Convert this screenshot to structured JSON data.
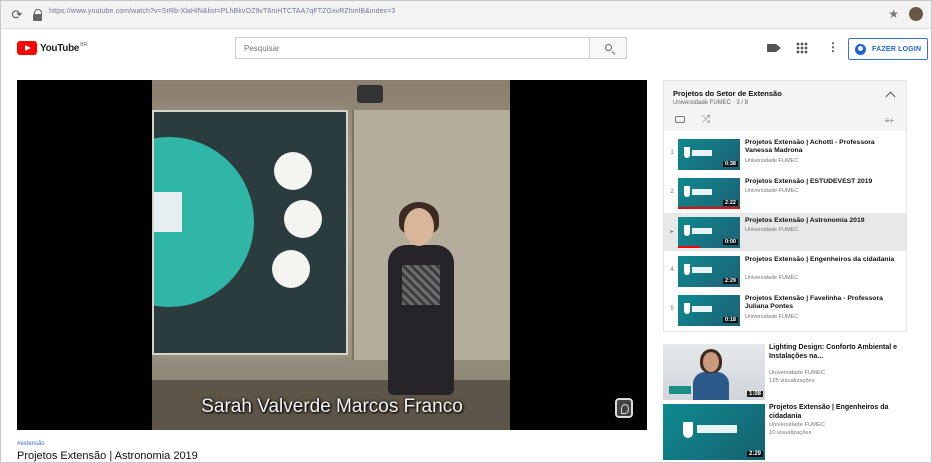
{
  "browser": {
    "url": "https://www.youtube.com/watch?v=SrRb-XlaHlN&list=PLhBkvOZ9vT6mHTCTAA7qFTZGxvRZhmlB&index=3",
    "reload_glyph": "⟳",
    "star_glyph": "★"
  },
  "header": {
    "logo_text": "YouTube",
    "logo_superscript": "BR",
    "search_placeholder": "Pesquisar",
    "more_glyph": "⋮",
    "login_label": "FAZER LOGIN"
  },
  "video": {
    "caption": "Sarah Valverde Marcos Franco",
    "hashtag": "#extensão",
    "title": "Projetos Extensão | Astronomia 2019"
  },
  "playlist": {
    "title": "Projetos do Setor de Extensão",
    "subtitle": "Universidade FUMEC · 3 / 8",
    "shuffle_glyph": "⤮",
    "save_glyph": "≡+",
    "items": [
      {
        "index": "1",
        "title": "Projetos Extensão | Achotti - Professora Vanessa Madrona",
        "channel": "Universidade FUMEC",
        "duration": "0:38",
        "progress": 0.0
      },
      {
        "index": "2",
        "title": "Projetos Extensão | ESTUDEVEST 2019",
        "channel": "Universidade FUMEC",
        "duration": "2:22",
        "progress": 1.0
      },
      {
        "index": "▸",
        "title": "Projetos Extensão | Astronomia 2019",
        "channel": "Universidade FUMEC",
        "duration": "0:00",
        "progress": 0.35
      },
      {
        "index": "4",
        "title": "Projetos Extensão | Engenheiros da cidadania",
        "channel": "Universidade FUMEC",
        "duration": "2:29",
        "progress": 0.0
      },
      {
        "index": "5",
        "title": "Projetos Extensão | Favelinha - Professora Juliana Pontes",
        "channel": "Universidade FUMEC",
        "duration": "0:18",
        "progress": 0.0
      }
    ]
  },
  "recommendations": [
    {
      "title": "Lighting Design: Conforto Ambiental e Instalações na...",
      "channel": "Universidade FUMEC",
      "views": "125 visualizações",
      "duration": "1:08",
      "thumb": "person"
    },
    {
      "title": "Projetos Extensão | Engenheiros da cidadania",
      "channel": "Universidade FUMEC",
      "views": "10 visualizações",
      "duration": "2:29",
      "thumb": "teal"
    }
  ],
  "colors": {
    "brand_red": "#ff0000",
    "link_blue": "#1e63d6",
    "thumb_teal": "#0e8b91"
  }
}
